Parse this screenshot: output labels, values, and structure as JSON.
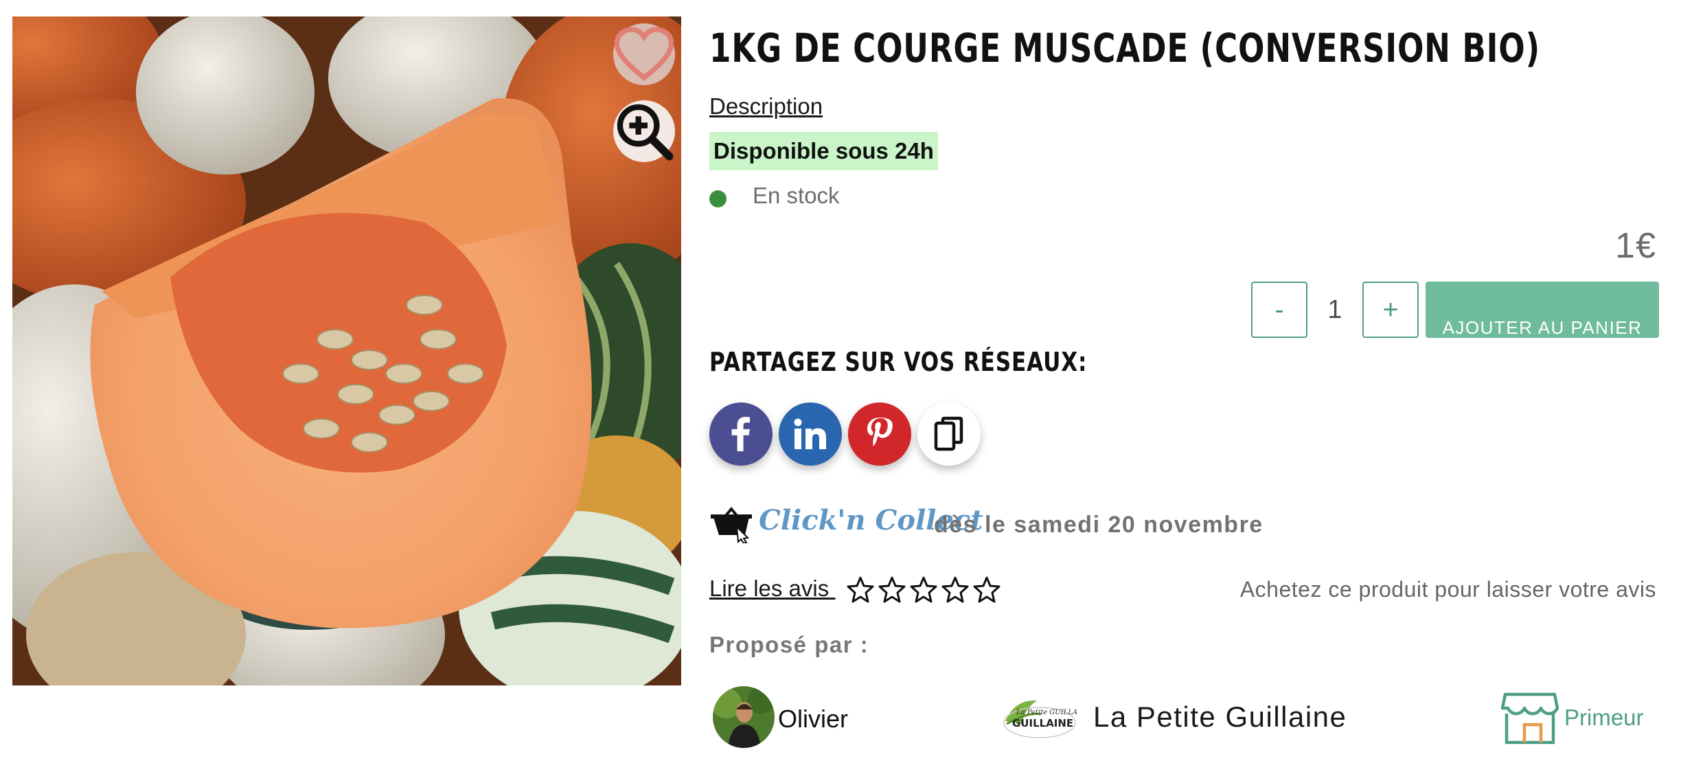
{
  "product": {
    "title": "1KG DE COURGE MUSCADE (CONVERSION BIO)",
    "description_link": "Description",
    "availability_badge": "Disponible sous 24h",
    "stock_status": "En stock",
    "price": "1€"
  },
  "purchase": {
    "minus_label": "-",
    "quantity": "1",
    "plus_label": "+",
    "add_to_cart_label": "AJOUTER AU PANIER"
  },
  "share": {
    "title": "PARTAGEZ SUR VOS RÉSEAUX:",
    "buttons": [
      {
        "icon": "facebook-icon",
        "color": "#4b4e93"
      },
      {
        "icon": "linkedin-icon",
        "color": "#2a66b0"
      },
      {
        "icon": "pinterest-icon",
        "color": "#d1272a"
      },
      {
        "icon": "copy-icon",
        "color": "#ffffff"
      }
    ]
  },
  "click_collect": {
    "logo_text": "Click'n Collect",
    "date_text": "dès le samedi 20 novembre"
  },
  "reviews": {
    "link_label": "Lire les avis ",
    "rating": 0,
    "max_rating": 5,
    "hint": "Achetez ce produit pour laisser votre avis"
  },
  "seller": {
    "proposed_label": "Proposé par :",
    "producer_name": "Olivier",
    "farm_logo_text": "La Petite GUILLAINE",
    "farm_name": "La Petite Guillaine",
    "category_icon": "shop-icon",
    "category": "Primeur"
  },
  "colors": {
    "accent_green": "#6fbb9d",
    "availability_bg": "#c9f5c9",
    "stock_dot": "#3a8f3f",
    "click_collect_blue": "#5f97c6"
  }
}
